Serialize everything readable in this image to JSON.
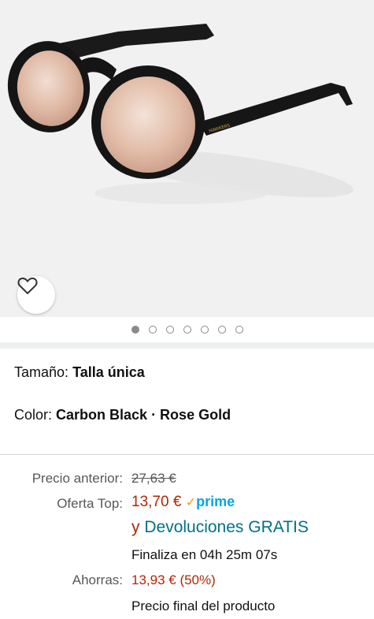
{
  "product": {
    "size_label": "Tamaño:",
    "size_value": "Talla única",
    "color_label": "Color:",
    "color_value": "Carbon Black · Rose Gold",
    "brand_imprint": "HAWKERS"
  },
  "gallery": {
    "image_count": 7,
    "active_index": 0
  },
  "pricing": {
    "previous_label": "Precio anterior:",
    "previous_value": "27,63 €",
    "offer_label": "Oferta Top:",
    "offer_value": "13,70 €",
    "prime_check": "✓",
    "prime_label": "prime",
    "returns_prefix": "y ",
    "returns_text": "Devoluciones GRATIS",
    "ends_text": "Finaliza en 04h 25m 07s",
    "savings_label": "Ahorras:",
    "savings_value": "13,93 € (50%)",
    "final_note": "Precio final del producto"
  },
  "colors": {
    "price_red": "#b12704",
    "link_teal": "#007185",
    "prime_blue": "#00a8e1",
    "prime_check": "#ff9900"
  }
}
